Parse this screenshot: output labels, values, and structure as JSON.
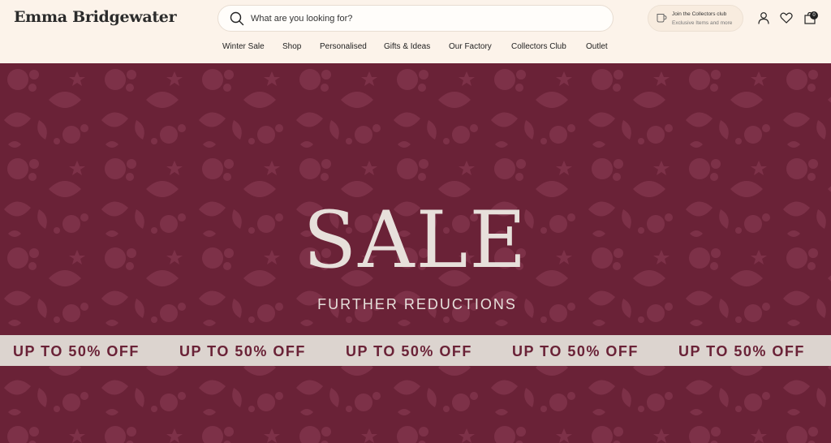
{
  "header": {
    "logo": "Emma Bridgewater",
    "search_placeholder": "What are you looking for?",
    "collectors_title": "Join the Collectors club",
    "collectors_subtitle": "Exclusive Items and more",
    "cart_count": "0"
  },
  "nav": {
    "items": [
      "Winter Sale",
      "Shop",
      "Personalised",
      "Gifts & Ideas",
      "Our Factory",
      "Collectors Club",
      "Outlet"
    ]
  },
  "hero": {
    "title": "SALE",
    "subtitle": "FURTHER REDUCTIONS",
    "ticker": [
      "UP TO 50% OFF",
      "UP TO 50% OFF",
      "UP TO 50% OFF",
      "UP TO 50% OFF",
      "UP TO 50% OFF"
    ]
  },
  "colors": {
    "header_bg": "#fcf3ea",
    "hero_bg": "#6a2237",
    "pattern": "#7d3148",
    "ticker_bg": "#dcd4cf",
    "ticker_text": "#6a2237",
    "hero_text": "#e7e0db"
  },
  "icons": [
    "search-icon",
    "cup-icon",
    "account-icon",
    "heart-icon",
    "cart-icon"
  ]
}
